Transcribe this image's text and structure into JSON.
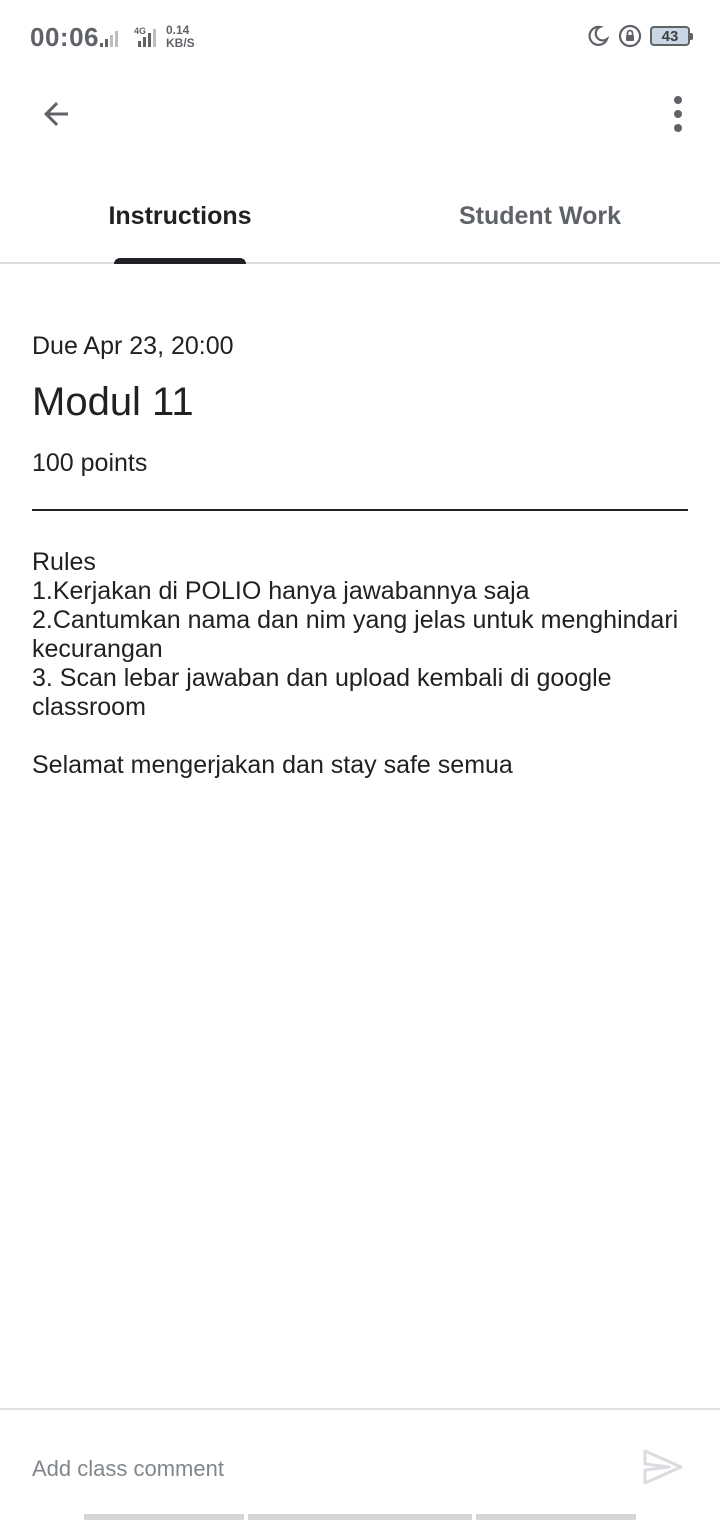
{
  "status_bar": {
    "time": "00:06",
    "network_type": "4G",
    "speed_value": "0.14",
    "speed_unit": "KB/S",
    "battery_level": "43"
  },
  "tabs": [
    {
      "label": "Instructions",
      "active": true
    },
    {
      "label": "Student Work",
      "active": false
    }
  ],
  "assignment": {
    "due": "Due Apr 23, 20:00",
    "title": "Modul 11",
    "points": "100 points",
    "description_lines": [
      "Rules",
      "1.Kerjakan di POLIO hanya jawabannya saja",
      "2.Cantumkan nama dan nim yang jelas untuk menghindari kecurangan",
      "3. Scan lebar jawaban dan upload kembali di google classroom",
      "",
      "Selamat mengerjakan dan stay safe semua"
    ]
  },
  "comment": {
    "placeholder": "Add class comment",
    "value": ""
  },
  "icons": {
    "back": "arrow-back-icon",
    "more": "more-vert-icon",
    "send": "send-icon"
  },
  "colors": {
    "text_primary": "#202124",
    "text_secondary": "#5f6368",
    "divider": "#dadce0"
  }
}
